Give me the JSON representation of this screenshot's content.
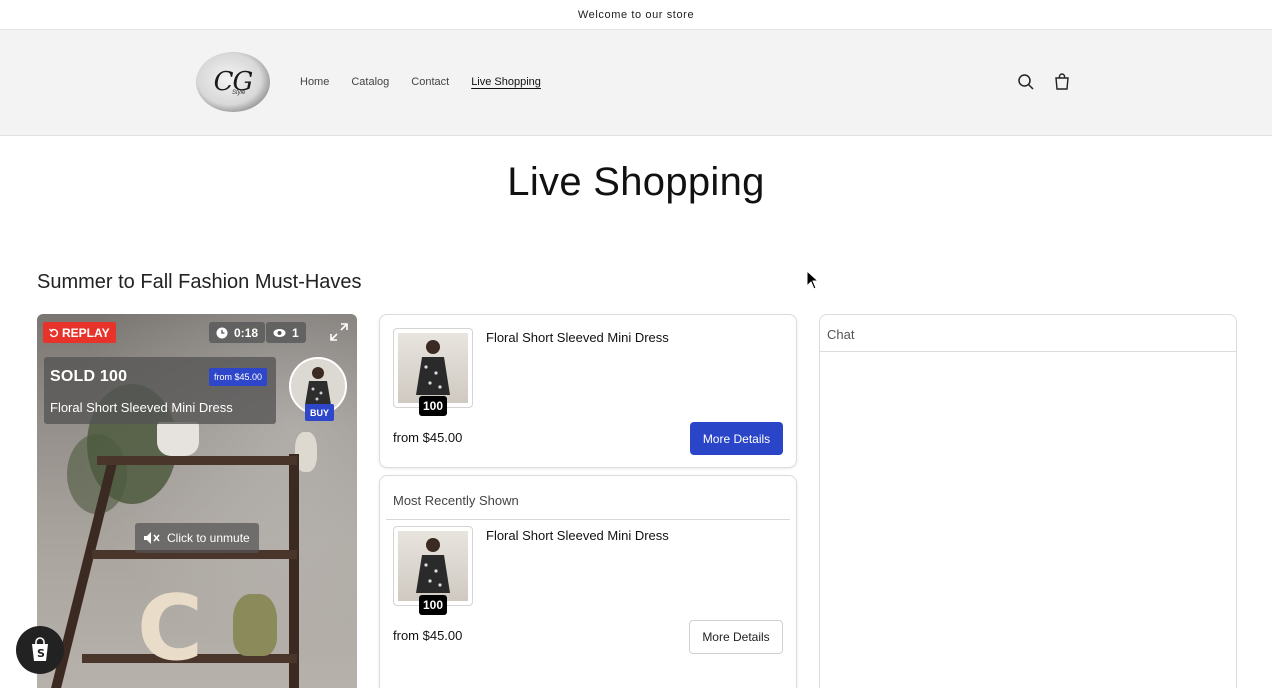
{
  "announcement": "Welcome to our store",
  "header": {
    "logo_text": "CG",
    "logo_sub": "Style",
    "nav": [
      {
        "label": "Home"
      },
      {
        "label": "Catalog"
      },
      {
        "label": "Contact"
      },
      {
        "label": "Live Shopping",
        "active": true
      }
    ],
    "icons": [
      "search-icon",
      "cart-icon"
    ]
  },
  "page_title": "Live Shopping",
  "section_title": "Summer to Fall Fashion Must-Haves",
  "video": {
    "replay_label": "REPLAY",
    "duration": "0:18",
    "viewers": "1",
    "sold_label": "SOLD 100",
    "sold_price": "from $45.00",
    "product_name": "Floral Short Sleeved Mini Dress",
    "buy_label": "BUY",
    "unmute_label": "Click to unmute",
    "decor_letter": "C"
  },
  "featured_product": {
    "name": "Floral Short Sleeved Mini Dress",
    "badge": "100",
    "price": "from $45.00",
    "button": "More Details"
  },
  "recent": {
    "title": "Most Recently Shown",
    "product": {
      "name": "Floral Short Sleeved Mini Dress",
      "badge": "100",
      "price": "from $45.00",
      "button": "More Details"
    }
  },
  "chat": {
    "title": "Chat"
  },
  "colors": {
    "accent": "#2a45c8",
    "replay": "#e8332a",
    "header_bg": "#f3f3f3"
  }
}
